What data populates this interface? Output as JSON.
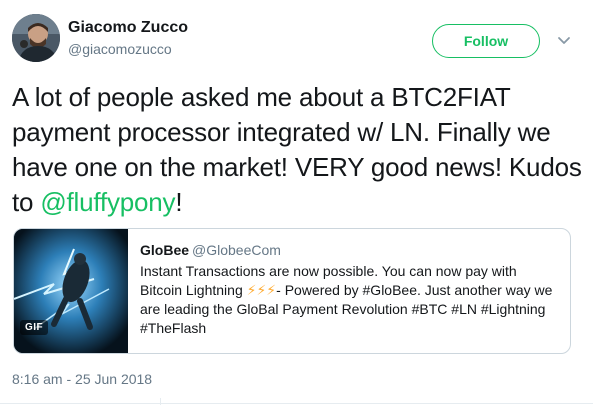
{
  "author": {
    "display_name": "Giacomo Zucco",
    "handle": "@giacomozucco"
  },
  "actions": {
    "follow_label": "Follow"
  },
  "tweet": {
    "text_before": "A lot of people asked me about a BTC2FIAT payment processor integrated w/ LN. Finally we have one on the market! VERY good news! Kudos to ",
    "mention": "@fluffypony",
    "text_after": "!"
  },
  "quoted_tweet": {
    "display_name": "GloBee",
    "handle": "@GlobeeCom",
    "text_part1": "Instant Transactions are now possible. You can now pay with Bitcoin Lightning ",
    "bolts": "⚡⚡⚡",
    "text_part2": "- Powered by #GloBee. Just another way we are leading the GloBal Payment Revolution #BTC #LN #Lightning #TheFlash",
    "media_badge": "GIF"
  },
  "timestamp": "8:16 am - 25 Jun 2018",
  "colors": {
    "accent": "#17bf63",
    "secondary_text": "#657786",
    "primary_text": "#14171a",
    "border": "#ccd6dd",
    "bolt": "#ffac33"
  }
}
